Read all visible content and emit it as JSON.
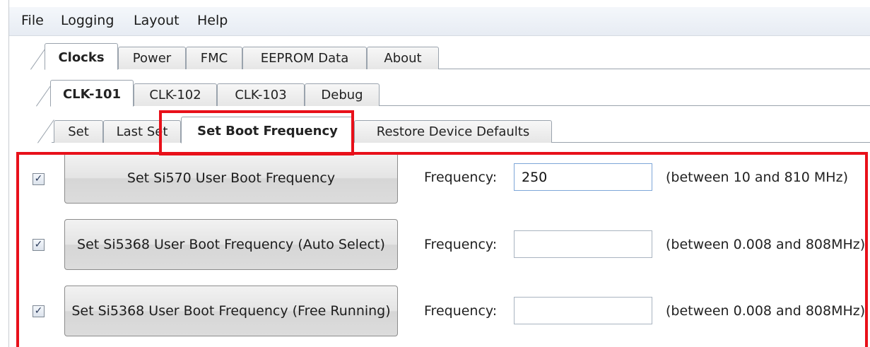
{
  "menubar": {
    "items": [
      "File",
      "Logging",
      "Layout",
      "Help"
    ]
  },
  "main_tabs": {
    "items": [
      "Clocks",
      "Power",
      "FMC",
      "EEPROM Data",
      "About"
    ],
    "active": "Clocks"
  },
  "clock_tabs": {
    "items": [
      "CLK-101",
      "CLK-102",
      "CLK-103",
      "Debug"
    ],
    "active": "CLK-101"
  },
  "sub_tabs": {
    "items": [
      "Set",
      "Last Set",
      "Set Boot Frequency",
      "Restore Device Defaults"
    ],
    "active": "Set Boot Frequency"
  },
  "rows": [
    {
      "checked": true,
      "button": "Set Si570 User Boot Frequency",
      "label": "Frequency:",
      "value": "250",
      "range": "(between 10 and 810 MHz)"
    },
    {
      "checked": true,
      "button": "Set Si5368 User Boot Frequency (Auto Select)",
      "label": "Frequency:",
      "value": "",
      "range": "(between 0.008 and 808MHz)"
    },
    {
      "checked": true,
      "button": "Set Si5368 User Boot Frequency (Free Running)",
      "label": "Frequency:",
      "value": "",
      "range": "(between 0.008 and 808MHz)"
    }
  ],
  "colors": {
    "highlight": "#e8101a",
    "checkmark": "✓"
  }
}
